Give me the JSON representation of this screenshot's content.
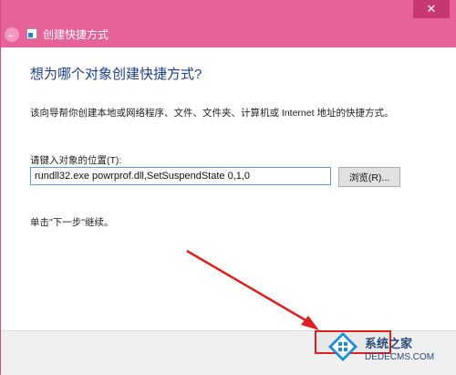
{
  "window": {
    "title": "创建快捷方式",
    "close_glyph": "✕",
    "back_glyph": "←"
  },
  "content": {
    "heading": "想为哪个对象创建快捷方式?",
    "description": "该向导帮你创建本地或网络程序、文件、文件夹、计算机或 Internet 地址的快捷方式。",
    "location_label": "请键入对象的位置(T):",
    "location_value": "rundll32.exe powrprof.dll,SetSuspendState 0,1,0",
    "browse_label": "浏览(R)...",
    "hint": "单击\"下一步\"继续。"
  },
  "footer": {
    "next_label": ""
  },
  "watermark": {
    "text": "系统之家",
    "url": "DEDECMS.COM"
  },
  "colors": {
    "window_border": "#e8629a",
    "heading": "#1f3f8a",
    "annotation": "#e02020"
  },
  "icons": {
    "back": "back-arrow-icon",
    "app": "shortcut-icon",
    "close": "close-icon"
  }
}
